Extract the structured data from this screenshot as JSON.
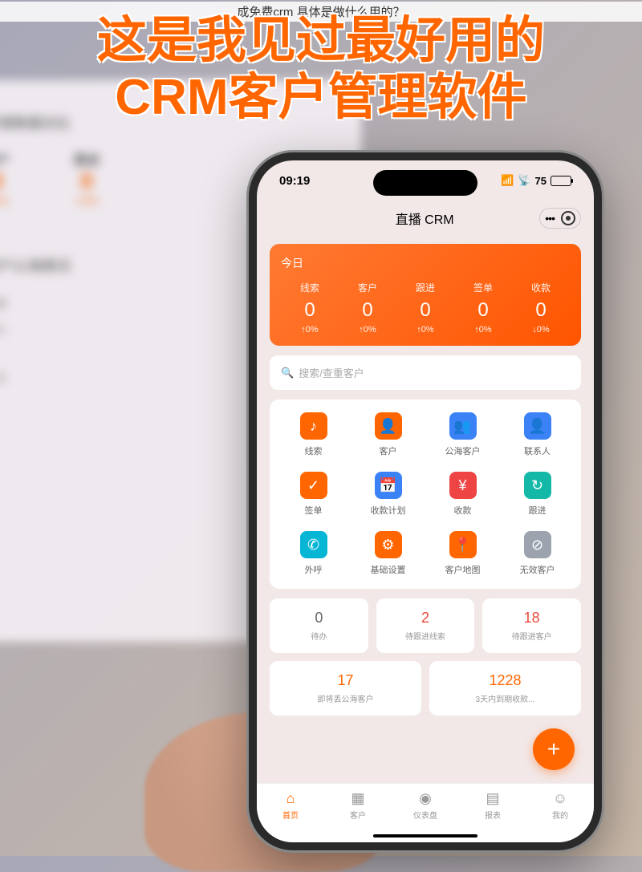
{
  "caption": "成免费crm 具体是做什么用的？",
  "headline_line1": "这是我见过最好用的",
  "headline_line2": "CRM客户管理软件",
  "bg": {
    "section1_title": "新增数据对比",
    "stats": [
      {
        "label": "客户",
        "value": "0",
        "pct": "+0%"
      },
      {
        "label": "跟进",
        "value": "0",
        "pct": "+0%"
      }
    ],
    "section2_title": "客户公海情况",
    "list": [
      "即将",
      "流入",
      "--",
      "小王",
      "--"
    ]
  },
  "status": {
    "time": "09:19",
    "battery": "75"
  },
  "app_title": "直播 CRM",
  "today": {
    "label": "今日",
    "stats": [
      {
        "name": "线索",
        "val": "0",
        "pct": "↑0%"
      },
      {
        "name": "客户",
        "val": "0",
        "pct": "↑0%"
      },
      {
        "name": "跟进",
        "val": "0",
        "pct": "↑0%"
      },
      {
        "name": "签单",
        "val": "0",
        "pct": "↑0%"
      },
      {
        "name": "收款",
        "val": "0",
        "pct": "↓0%"
      }
    ]
  },
  "search_placeholder": "搜索/查重客户",
  "grid": [
    {
      "label": "线索",
      "color": "#ff6600",
      "glyph": "♪"
    },
    {
      "label": "客户",
      "color": "#ff6600",
      "glyph": "👤"
    },
    {
      "label": "公海客户",
      "color": "#3b82f6",
      "glyph": "👥"
    },
    {
      "label": "联系人",
      "color": "#3b82f6",
      "glyph": "👤"
    },
    {
      "label": "签单",
      "color": "#ff6600",
      "glyph": "✓"
    },
    {
      "label": "收款计划",
      "color": "#3b82f6",
      "glyph": "📅"
    },
    {
      "label": "收款",
      "color": "#ef4444",
      "glyph": "¥"
    },
    {
      "label": "跟进",
      "color": "#14b8a6",
      "glyph": "↻"
    },
    {
      "label": "外呼",
      "color": "#06b6d4",
      "glyph": "✆"
    },
    {
      "label": "基础设置",
      "color": "#ff6600",
      "glyph": "⚙"
    },
    {
      "label": "客户地图",
      "color": "#ff6600",
      "glyph": "📍"
    },
    {
      "label": "无效客户",
      "color": "#9ca3af",
      "glyph": "⊘"
    }
  ],
  "stat_cards_row1": [
    {
      "val": "0",
      "label": "待办",
      "cls": "gray-val"
    },
    {
      "val": "2",
      "label": "待跟进线索",
      "cls": "red-val"
    },
    {
      "val": "18",
      "label": "待跟进客户",
      "cls": "red-val"
    }
  ],
  "stat_cards_row2": [
    {
      "val": "17",
      "label": "即将丢公海客户",
      "cls": "orange-val"
    },
    {
      "val": "1228",
      "label": "3天内到期收款...",
      "cls": "orange-val"
    }
  ],
  "nav": [
    {
      "label": "首页",
      "icon": "⌂",
      "active": true
    },
    {
      "label": "客户",
      "icon": "▦",
      "active": false
    },
    {
      "label": "仪表盘",
      "icon": "◉",
      "active": false
    },
    {
      "label": "报表",
      "icon": "▤",
      "active": false
    },
    {
      "label": "我的",
      "icon": "☺",
      "active": false
    }
  ]
}
